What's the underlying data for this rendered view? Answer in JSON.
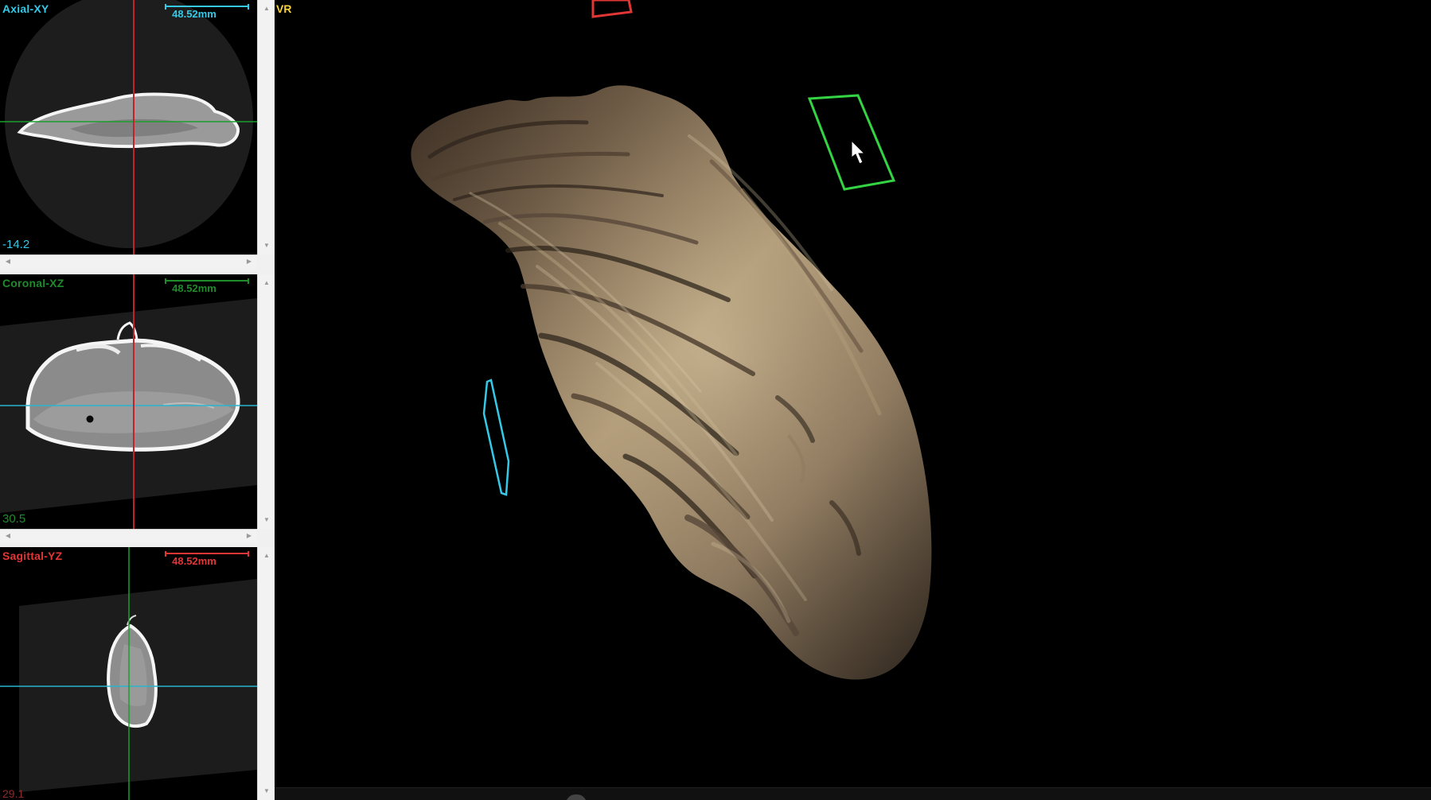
{
  "views": {
    "axial": {
      "label": "Axial-XY",
      "scale": "48.52mm",
      "slice_value": "-14.2",
      "color": "#35c9e7"
    },
    "coronal": {
      "label": "Coronal-XZ",
      "scale": "48.52mm",
      "slice_value": "30.5",
      "color": "#1f8b2a"
    },
    "sagittal": {
      "label": "Sagittal-YZ",
      "scale": "48.52mm",
      "slice_value": "29.1",
      "color": "#e23636"
    }
  },
  "main_view": {
    "label": "VR",
    "label_color": "#f7d43d"
  },
  "widgets": {
    "green_plane_color": "#34d343",
    "cyan_plane_color": "#35c9e7",
    "red_plane_color": "#e23636",
    "cursor_icon": "mouse-pointer-icon"
  },
  "colors": {
    "shell_dark": "#2a2118",
    "shell_mid": "#6a5a45",
    "shell_light": "#c7b591",
    "panel_bg": "#f0f0f0"
  }
}
